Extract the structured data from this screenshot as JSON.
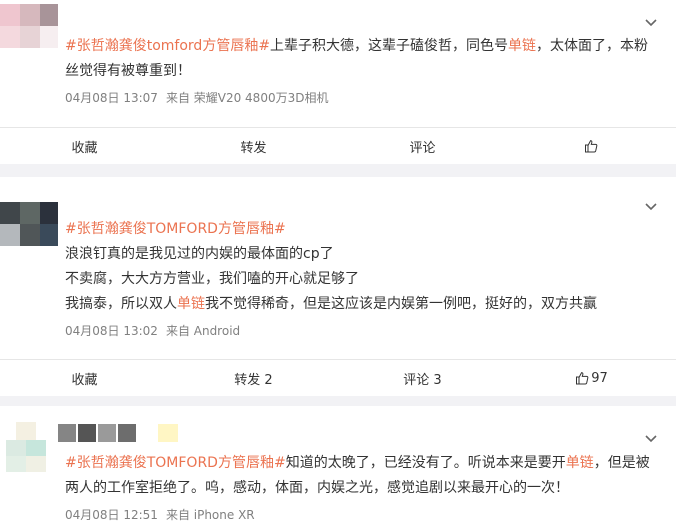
{
  "posts": [
    {
      "topic": "#张哲瀚龚俊tomford方管唇釉#",
      "lines": [
        {
          "a": "上辈子积大德，这辈子磕俊哲，同色号",
          "hl": "单链",
          "b": "，太体面了，本粉"
        },
        {
          "a": "丝觉得有被尊重到！",
          "hl": "",
          "b": ""
        }
      ],
      "time": "04月08日 13:07",
      "source": "来自 荣耀V20 4800万3D相机",
      "actions": {
        "favorite": "收藏",
        "repost": "转发",
        "comment": "评论",
        "like": ""
      }
    },
    {
      "topic": "#张哲瀚龚俊TOMFORD方管唇釉#",
      "lines": [
        {
          "a": "浪浪钉真的是我见过的内娱的最体面的cp了",
          "hl": "",
          "b": ""
        },
        {
          "a": "不卖腐，大大方方营业，我们嗑的开心就足够了",
          "hl": "",
          "b": ""
        },
        {
          "a": "我搞泰，所以双人",
          "hl": "单链",
          "b": "我不觉得稀奇，但是这应该是内娱第一例吧，挺好的，双方共赢"
        }
      ],
      "time": "04月08日 13:02",
      "source": "来自 Android",
      "actions": {
        "favorite": "收藏",
        "repost": "转发 2",
        "comment": "评论 3",
        "like": "97"
      }
    },
    {
      "topic": "#张哲瀚龚俊TOMFORD方管唇釉#",
      "lines": [
        {
          "a": "知道的太晚了，已经没有了。听说本来是要开",
          "hl": "单链",
          "b": "，但是被"
        },
        {
          "a": "两人的工作室拒绝了。呜，感动，体面，内娱之光，感觉追剧以来最开心的一次！",
          "hl": "",
          "b": ""
        }
      ],
      "time": "04月08日 12:51",
      "source": "来自 iPhone XR",
      "actions": {}
    }
  ],
  "colors": {
    "topic": "#eb7350",
    "meta": "#808080",
    "background": "#f2f2f5"
  },
  "icons": {
    "chevron": "chevron-down-icon",
    "like": "thumbs-up-icon"
  }
}
